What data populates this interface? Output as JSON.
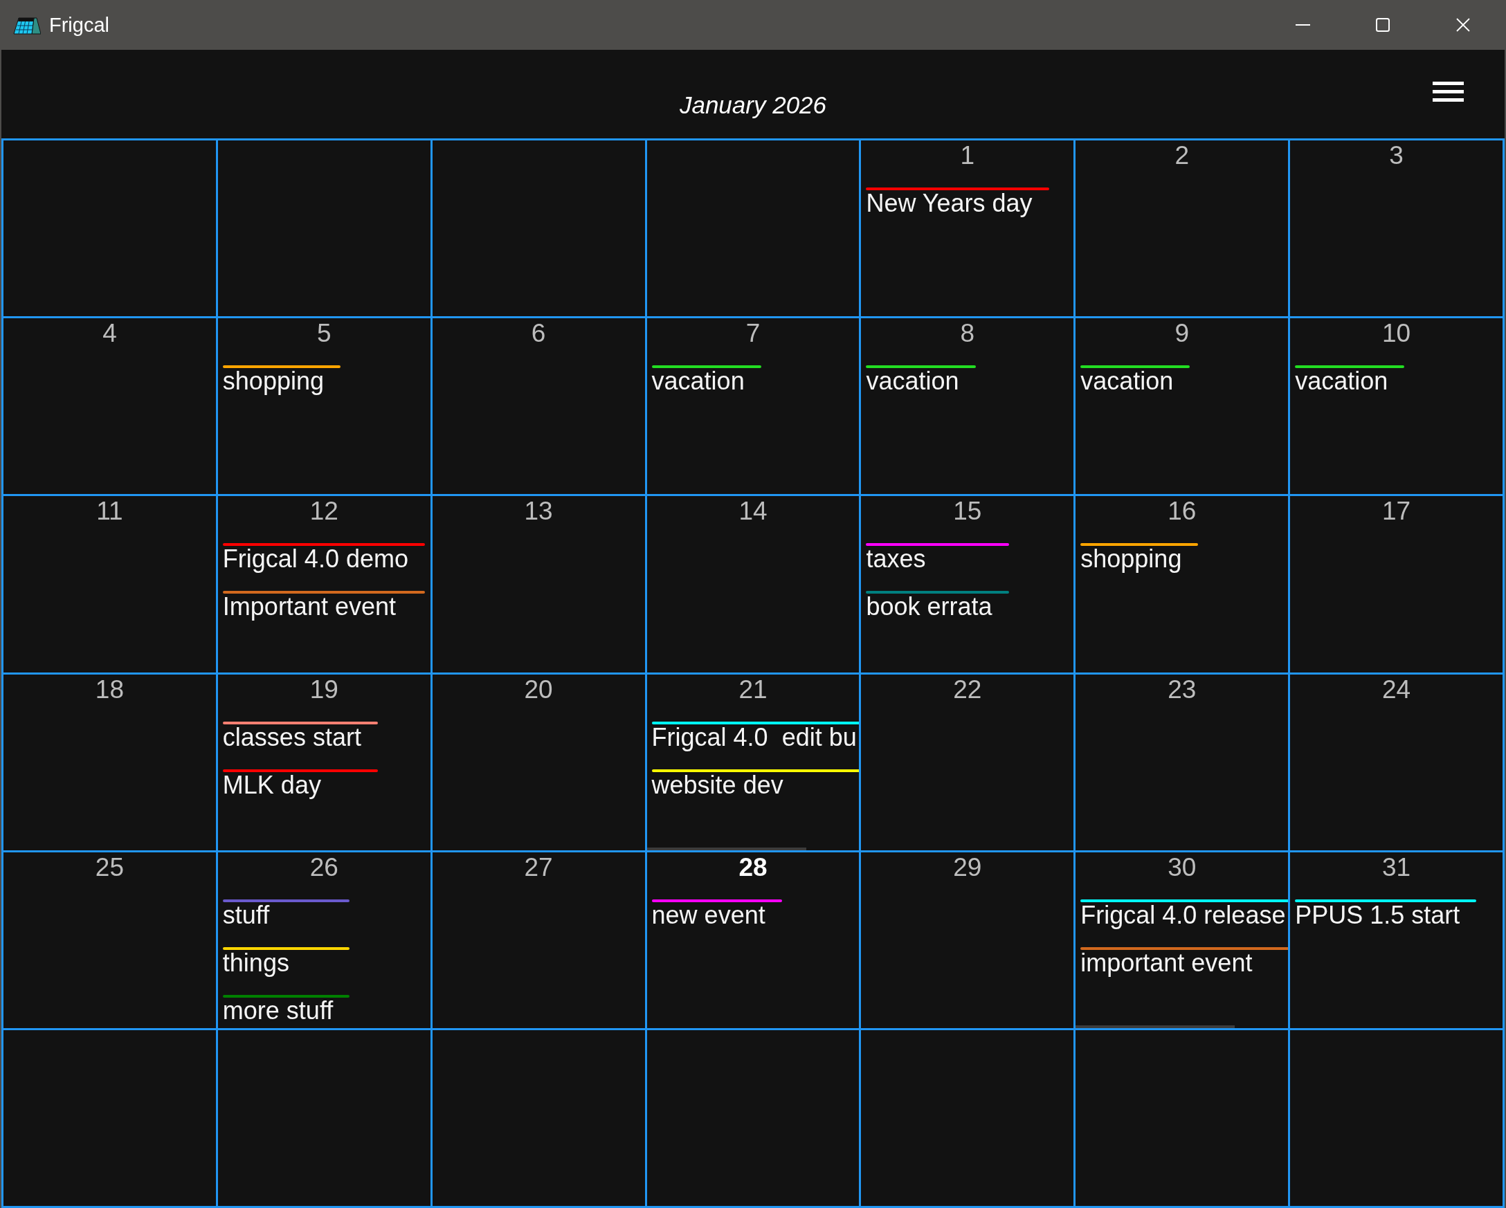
{
  "window": {
    "title": "Frigcal"
  },
  "header": {
    "month": "January 2026"
  },
  "weeks": [
    [
      {
        "kind": "blank"
      },
      {
        "kind": "blank"
      },
      {
        "kind": "blank"
      },
      {
        "kind": "blank"
      },
      {
        "kind": "day",
        "day": "1",
        "today": false,
        "scrollbar": false,
        "events": [
          {
            "title": "New Years day",
            "color": "#ff0000"
          }
        ]
      },
      {
        "kind": "day",
        "day": "2",
        "today": false,
        "scrollbar": false
      },
      {
        "kind": "day",
        "day": "3",
        "today": false,
        "scrollbar": false
      }
    ],
    [
      {
        "kind": "day",
        "day": "4",
        "today": false,
        "scrollbar": false
      },
      {
        "kind": "day",
        "day": "5",
        "today": false,
        "scrollbar": false,
        "events": [
          {
            "title": "shopping",
            "color": "#ffa500"
          }
        ]
      },
      {
        "kind": "day",
        "day": "6",
        "today": false,
        "scrollbar": false
      },
      {
        "kind": "day",
        "day": "7",
        "today": false,
        "scrollbar": false,
        "events": [
          {
            "title": "vacation",
            "color": "#22dd22"
          }
        ]
      },
      {
        "kind": "day",
        "day": "8",
        "today": false,
        "scrollbar": false,
        "events": [
          {
            "title": "vacation",
            "color": "#22dd22"
          }
        ]
      },
      {
        "kind": "day",
        "day": "9",
        "today": false,
        "scrollbar": false,
        "events": [
          {
            "title": "vacation",
            "color": "#22dd22"
          }
        ]
      },
      {
        "kind": "day",
        "day": "10",
        "today": false,
        "scrollbar": false,
        "events": [
          {
            "title": "vacation",
            "color": "#22dd22"
          }
        ]
      }
    ],
    [
      {
        "kind": "day",
        "day": "11",
        "today": false,
        "scrollbar": false
      },
      {
        "kind": "day",
        "day": "12",
        "today": false,
        "scrollbar": false,
        "events": [
          {
            "title": "Frigcal 4.0 demo",
            "color": "#ff0000"
          },
          {
            "title": "Important event",
            "color": "#d2691e"
          }
        ]
      },
      {
        "kind": "day",
        "day": "13",
        "today": false,
        "scrollbar": false
      },
      {
        "kind": "day",
        "day": "14",
        "today": false,
        "scrollbar": false
      },
      {
        "kind": "day",
        "day": "15",
        "today": false,
        "scrollbar": false,
        "events": [
          {
            "title": "taxes",
            "color": "#ff00ff"
          },
          {
            "title": "book errata",
            "color": "#008080"
          }
        ]
      },
      {
        "kind": "day",
        "day": "16",
        "today": false,
        "scrollbar": false,
        "events": [
          {
            "title": "shopping",
            "color": "#ffa500"
          }
        ]
      },
      {
        "kind": "day",
        "day": "17",
        "today": false,
        "scrollbar": false
      }
    ],
    [
      {
        "kind": "day",
        "day": "18",
        "today": false,
        "scrollbar": false
      },
      {
        "kind": "day",
        "day": "19",
        "today": false,
        "scrollbar": false,
        "events": [
          {
            "title": "classes start",
            "color": "#fa8072"
          },
          {
            "title": "MLK day",
            "color": "#ff0000"
          }
        ]
      },
      {
        "kind": "day",
        "day": "20",
        "today": false,
        "scrollbar": false
      },
      {
        "kind": "day",
        "day": "21",
        "today": false,
        "scrollbar": true,
        "events": [
          {
            "title": "Frigcal 4.0  edit bu",
            "color": "#00ffff"
          },
          {
            "title": "website dev",
            "color": "#ffff00"
          }
        ]
      },
      {
        "kind": "day",
        "day": "22",
        "today": false,
        "scrollbar": false
      },
      {
        "kind": "day",
        "day": "23",
        "today": false,
        "scrollbar": false
      },
      {
        "kind": "day",
        "day": "24",
        "today": false,
        "scrollbar": false
      }
    ],
    [
      {
        "kind": "day",
        "day": "25",
        "today": false,
        "scrollbar": false
      },
      {
        "kind": "day",
        "day": "26",
        "today": false,
        "scrollbar": false,
        "events": [
          {
            "title": "stuff",
            "color": "#6a5acd"
          },
          {
            "title": "things",
            "color": "#ffd700"
          },
          {
            "title": "more stuff",
            "color": "#008000"
          }
        ]
      },
      {
        "kind": "day",
        "day": "27",
        "today": false,
        "scrollbar": false
      },
      {
        "kind": "day",
        "day": "28",
        "today": true,
        "scrollbar": false,
        "events": [
          {
            "title": "new event",
            "color": "#ff00ff"
          }
        ]
      },
      {
        "kind": "day",
        "day": "29",
        "today": false,
        "scrollbar": false
      },
      {
        "kind": "day",
        "day": "30",
        "today": false,
        "scrollbar": true,
        "events": [
          {
            "title": "Frigcal 4.0 release",
            "color": "#00ffff"
          },
          {
            "title": "important event",
            "color": "#d2691e"
          }
        ]
      },
      {
        "kind": "day",
        "day": "31",
        "today": false,
        "scrollbar": false,
        "events": [
          {
            "title": "PPUS 1.5 start",
            "color": "#00ffff"
          }
        ]
      }
    ],
    [
      {
        "kind": "blank"
      },
      {
        "kind": "blank"
      },
      {
        "kind": "blank"
      },
      {
        "kind": "blank"
      },
      {
        "kind": "blank"
      },
      {
        "kind": "blank"
      },
      {
        "kind": "blank"
      }
    ]
  ]
}
